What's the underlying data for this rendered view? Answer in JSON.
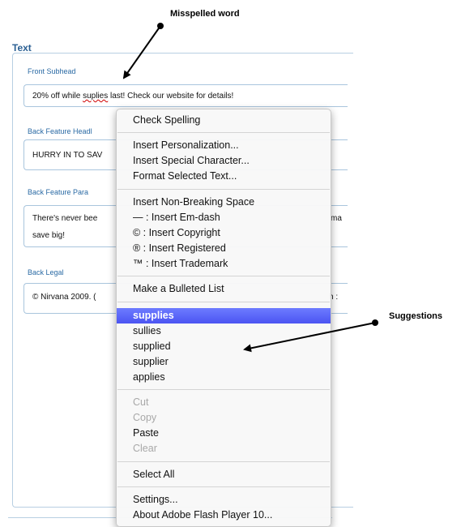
{
  "panel": {
    "title": "Text"
  },
  "fields": [
    {
      "label": "Front Subhead",
      "value_before": "20% off while ",
      "misspelled_word": "suplies",
      "value_after": " last!  Check our website for details!"
    },
    {
      "label": "Back Feature Headl",
      "value": "HURRY IN TO SAV"
    },
    {
      "label": "Back Feature Para",
      "value_line1": "There's never bee",
      "value_line1_tail": "ma",
      "value_line2": "save big!"
    },
    {
      "label": "Back Legal",
      "value": "© Nirvana 2009. (",
      "value_tail": "h :"
    }
  ],
  "context_menu": {
    "check_spelling": "Check Spelling",
    "insert_personalization": "Insert Personalization...",
    "insert_special_character": "Insert Special Character...",
    "format_selected_text": "Format Selected Text...",
    "insert_non_breaking_space": "Insert Non-Breaking Space",
    "insert_em_dash": "— : Insert Em-dash",
    "insert_copyright": "© : Insert Copyright",
    "insert_registered": "® : Insert Registered",
    "insert_trademark": "™ : Insert Trademark",
    "make_bulleted_list": "Make a Bulleted List",
    "suggestions": [
      "supplies",
      "sullies",
      "supplied",
      "supplier",
      "applies"
    ],
    "selected_suggestion_index": 0,
    "cut": "Cut",
    "copy": "Copy",
    "paste": "Paste",
    "clear": "Clear",
    "select_all": "Select All",
    "settings": "Settings...",
    "about": "About Adobe Flash Player 10..."
  },
  "callouts": {
    "misspelled": "Misspelled word",
    "suggestions": "Suggestions"
  }
}
